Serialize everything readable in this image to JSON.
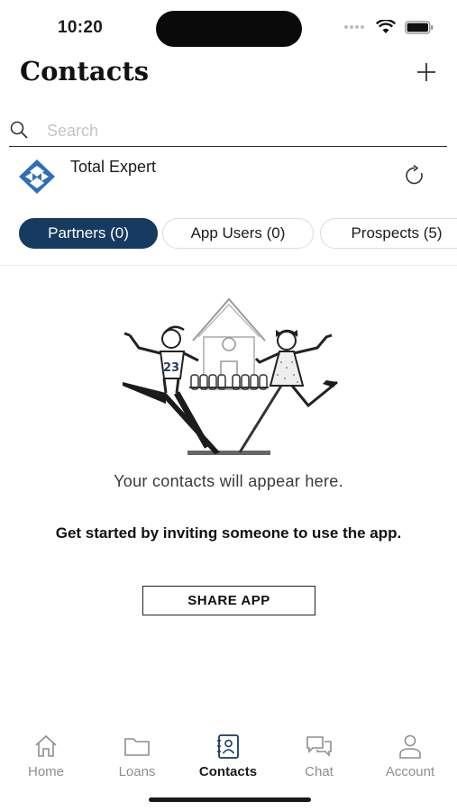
{
  "status_bar": {
    "time": "10:20"
  },
  "header": {
    "title": "Contacts"
  },
  "search": {
    "placeholder": "Search",
    "value": ""
  },
  "organization": {
    "name": "Total Expert"
  },
  "tabs": [
    {
      "label": "Partners (0)",
      "active": true
    },
    {
      "label": "App Users (0)",
      "active": false
    },
    {
      "label": "Prospects (5)",
      "active": false
    }
  ],
  "empty_state": {
    "jersey_number": "23",
    "message": "Your contacts will appear here.",
    "cta": "Get started by inviting someone to use the app.",
    "button_label": "SHARE APP"
  },
  "tab_bar": {
    "items": [
      {
        "label": "Home",
        "icon": "home-icon",
        "active": false
      },
      {
        "label": "Loans",
        "icon": "folder-icon",
        "active": false
      },
      {
        "label": "Contacts",
        "icon": "contacts-book-icon",
        "active": true
      },
      {
        "label": "Chat",
        "icon": "chat-bubbles-icon",
        "active": false
      },
      {
        "label": "Account",
        "icon": "person-icon",
        "active": false
      }
    ]
  },
  "colors": {
    "accent": "#173a61",
    "logo_blue": "#2f6fb9",
    "inactive": "#8e8e8e"
  }
}
